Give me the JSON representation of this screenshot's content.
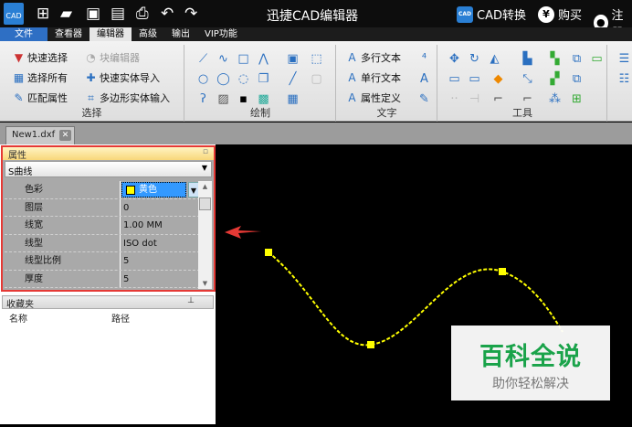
{
  "titlebar": {
    "title": "迅捷CAD编辑器",
    "logo": "CAD",
    "quick_access": [
      "new-icon",
      "open-icon",
      "save-icon",
      "save-as-icon",
      "print-icon",
      "undo-icon",
      "redo-icon"
    ],
    "cad_convert": "CAD转换",
    "buy": "购买",
    "register": "注册"
  },
  "menu": [
    "文件",
    "查看器",
    "编辑器",
    "高级",
    "输出",
    "VIP功能"
  ],
  "ribbon": {
    "select": {
      "label": "选择",
      "items": [
        "快速选择",
        "选择所有",
        "匹配属性",
        "块编辑器",
        "快速实体导入",
        "多边形实体输入"
      ]
    },
    "draw": {
      "label": "绘制"
    },
    "text": {
      "label": "文字",
      "items": [
        "多行文本",
        "单行文本",
        "属性定义"
      ]
    },
    "tools": {
      "label": "工具"
    }
  },
  "doc_tab": {
    "name": "New1.dxf"
  },
  "properties": {
    "title": "属性",
    "object": "S曲线",
    "rows": [
      {
        "k": "色彩",
        "v": "黄色"
      },
      {
        "k": "图层",
        "v": "0"
      },
      {
        "k": "线宽",
        "v": "1.00 MM"
      },
      {
        "k": "线型",
        "v": "ISO dot"
      },
      {
        "k": "线型比例",
        "v": "5"
      },
      {
        "k": "厚度",
        "v": "5"
      }
    ]
  },
  "favorites": {
    "title": "收藏夹",
    "cols": [
      "名称",
      "路径"
    ]
  },
  "watermark": {
    "title": "百科全说",
    "subtitle": "助你轻松解决"
  },
  "colors": {
    "curve": "#ffff00",
    "accent": "#2e6fc4",
    "highlight": "#e53935"
  }
}
